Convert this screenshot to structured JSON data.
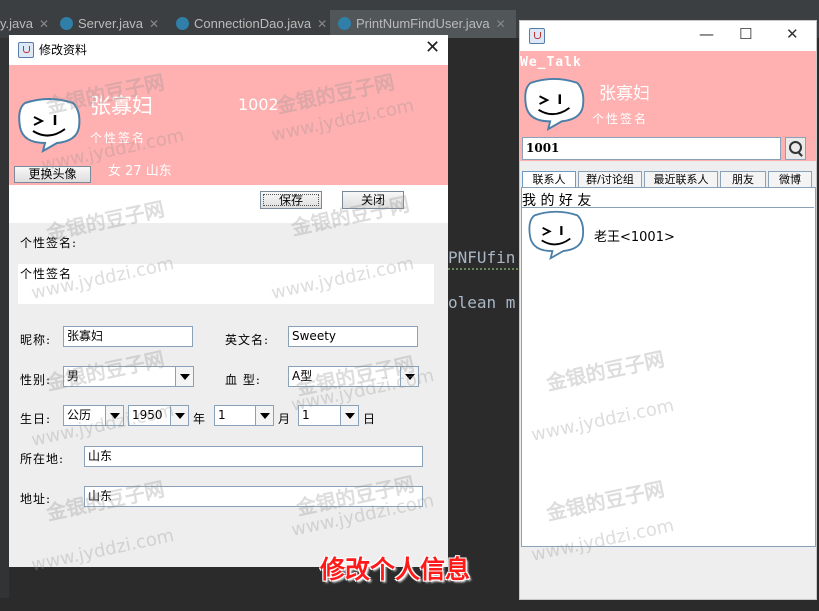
{
  "ide": {
    "tabs": [
      {
        "label": "y.java"
      },
      {
        "label": "Server.java"
      },
      {
        "label": "ConnectionDao.java"
      },
      {
        "label": "PrintNumFindUser.java"
      }
    ],
    "code_line_1": "PNFUfin",
    "code_line_2": "olean m"
  },
  "profile_dialog": {
    "title": "修改资料",
    "name": "张寡妇",
    "user_id": "1002",
    "signature": "个性签名",
    "gender_age_location": "女 27 山东",
    "change_avatar_button": "更换头像",
    "save_button": "保存",
    "close_button": "关闭",
    "signature_label": "个性签名:",
    "signature_value": "个性签名",
    "nickname_label": "昵称:",
    "nickname_value": "张寡妇",
    "english_name_label": "英文名:",
    "english_name_value": "Sweety",
    "gender_label": "性别:",
    "gender_value": "男",
    "blood_type_label": "血 型:",
    "blood_type_value": "A型",
    "birthday_label": "生日:",
    "calendar_value": "公历",
    "year_value": "1950",
    "year_unit": "年",
    "month_value": "1",
    "month_unit": "月",
    "day_value": "1",
    "day_unit": "日",
    "location_label": "所在地:",
    "location_value": "山东",
    "address_label": "地址:",
    "address_value": "山东"
  },
  "chat_window": {
    "app_title": "We_Talk",
    "name": "张寡妇",
    "signature": "个性签名",
    "search_value": "1001",
    "tabs": [
      {
        "label": "联系人"
      },
      {
        "label": "群/讨论组"
      },
      {
        "label": "最近联系人"
      },
      {
        "label": "朋友"
      },
      {
        "label": "微博"
      }
    ],
    "section_title": "我 的 好 友",
    "friends": [
      {
        "label": "老王<1001>"
      }
    ]
  },
  "watermark": {
    "cn": "金银的豆子网",
    "url": "www.jyddzi.com"
  },
  "caption": "修改个人信息",
  "colors": {
    "header_pink": "#ffb0b0",
    "caption_red": "#ff1a1a",
    "ide_background": "#2b2b2b"
  }
}
